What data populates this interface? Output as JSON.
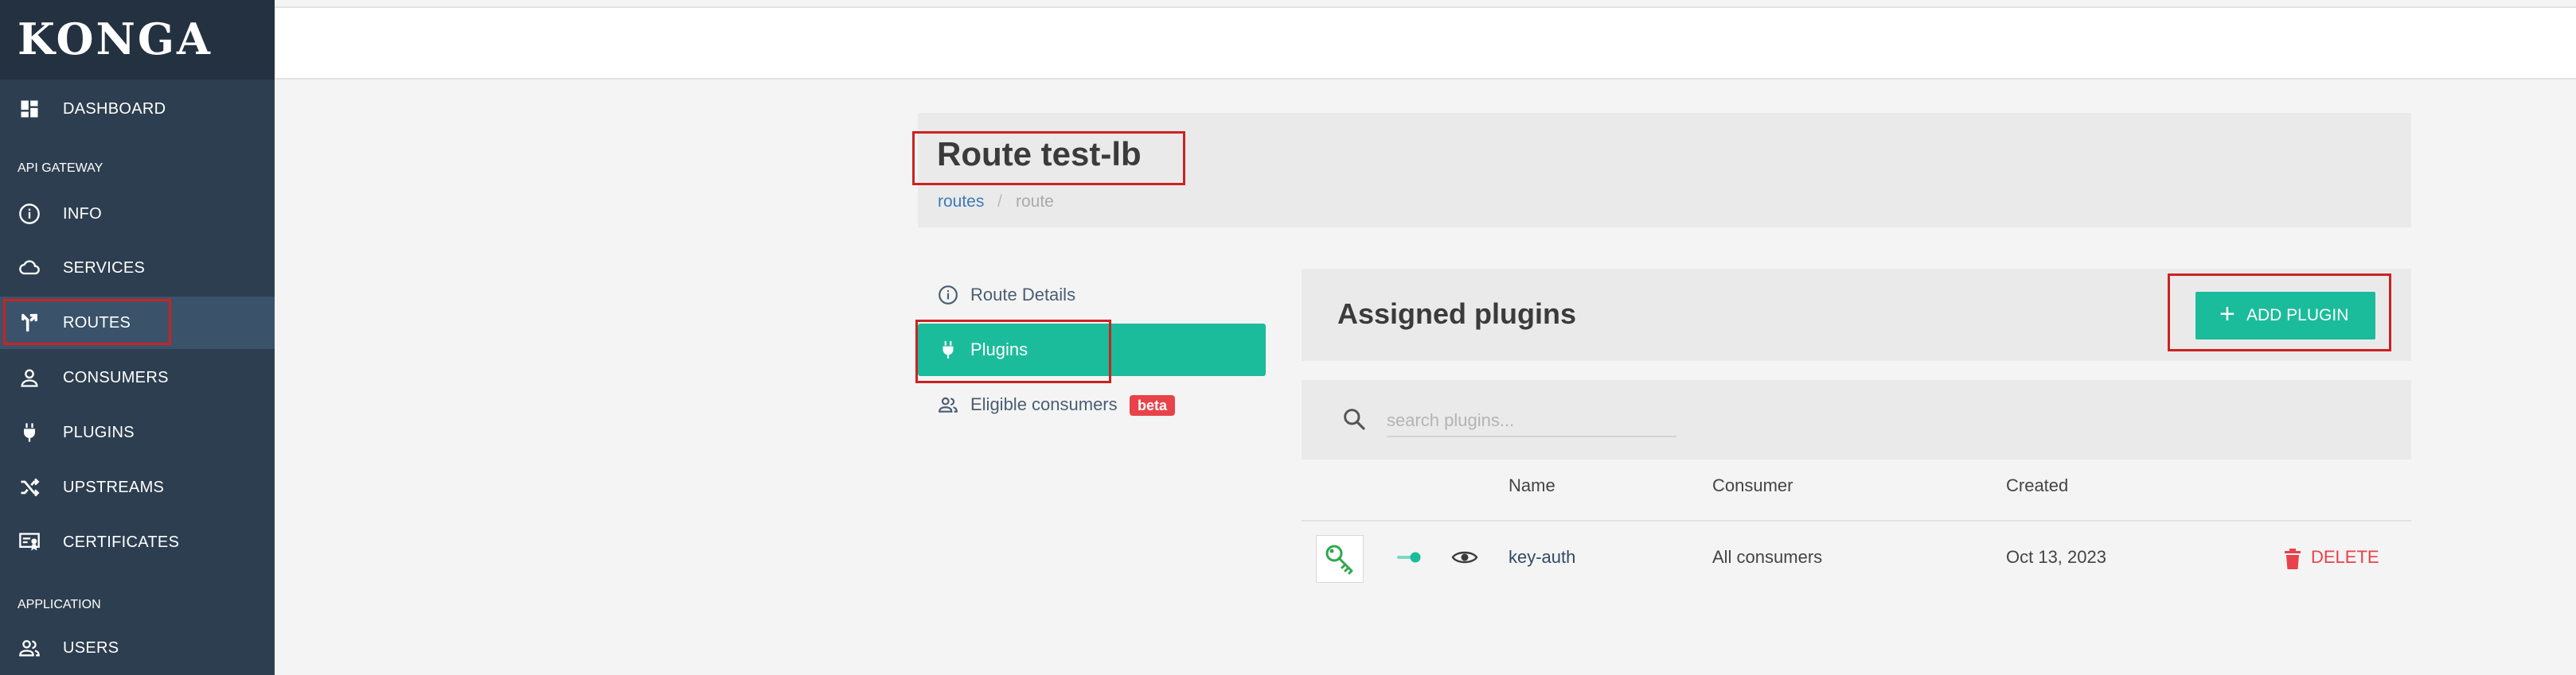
{
  "brand": {
    "logo": "KONGA"
  },
  "sidebar": {
    "items": [
      {
        "label": "DASHBOARD",
        "icon": "dashboard-icon"
      },
      {
        "label": "INFO",
        "icon": "info-icon"
      },
      {
        "label": "SERVICES",
        "icon": "cloud-icon"
      },
      {
        "label": "ROUTES",
        "icon": "routes-icon",
        "active": true
      },
      {
        "label": "CONSUMERS",
        "icon": "user-icon"
      },
      {
        "label": "PLUGINS",
        "icon": "plug-icon"
      },
      {
        "label": "UPSTREAMS",
        "icon": "shuffle-icon"
      },
      {
        "label": "CERTIFICATES",
        "icon": "certificate-icon"
      },
      {
        "label": "USERS",
        "icon": "users-icon"
      }
    ],
    "sections": {
      "api_gateway": "API GATEWAY",
      "application": "APPLICATION"
    }
  },
  "page": {
    "title": "Route test-lb",
    "breadcrumb": {
      "link": "routes",
      "separator": "/",
      "current": "route"
    }
  },
  "tabs": [
    {
      "label": "Route Details",
      "icon": "info-icon"
    },
    {
      "label": "Plugins",
      "icon": "plug-icon",
      "active": true
    },
    {
      "label": "Eligible consumers",
      "icon": "users-icon",
      "badge": "beta"
    }
  ],
  "plugins_panel": {
    "title": "Assigned plugins",
    "add_button": "ADD PLUGIN",
    "search_placeholder": "search plugins...",
    "columns": [
      "Name",
      "Consumer",
      "Created"
    ],
    "rows": [
      {
        "name": "key-auth",
        "consumer": "All consumers",
        "created": "Oct 13, 2023",
        "enabled": true,
        "delete_label": "DELETE"
      }
    ]
  },
  "colors": {
    "sidebar": "#2d3e50",
    "accent": "#1bbc9b",
    "danger": "#e8424a",
    "link": "#3d7ab8",
    "highlight": "#cc2222"
  }
}
